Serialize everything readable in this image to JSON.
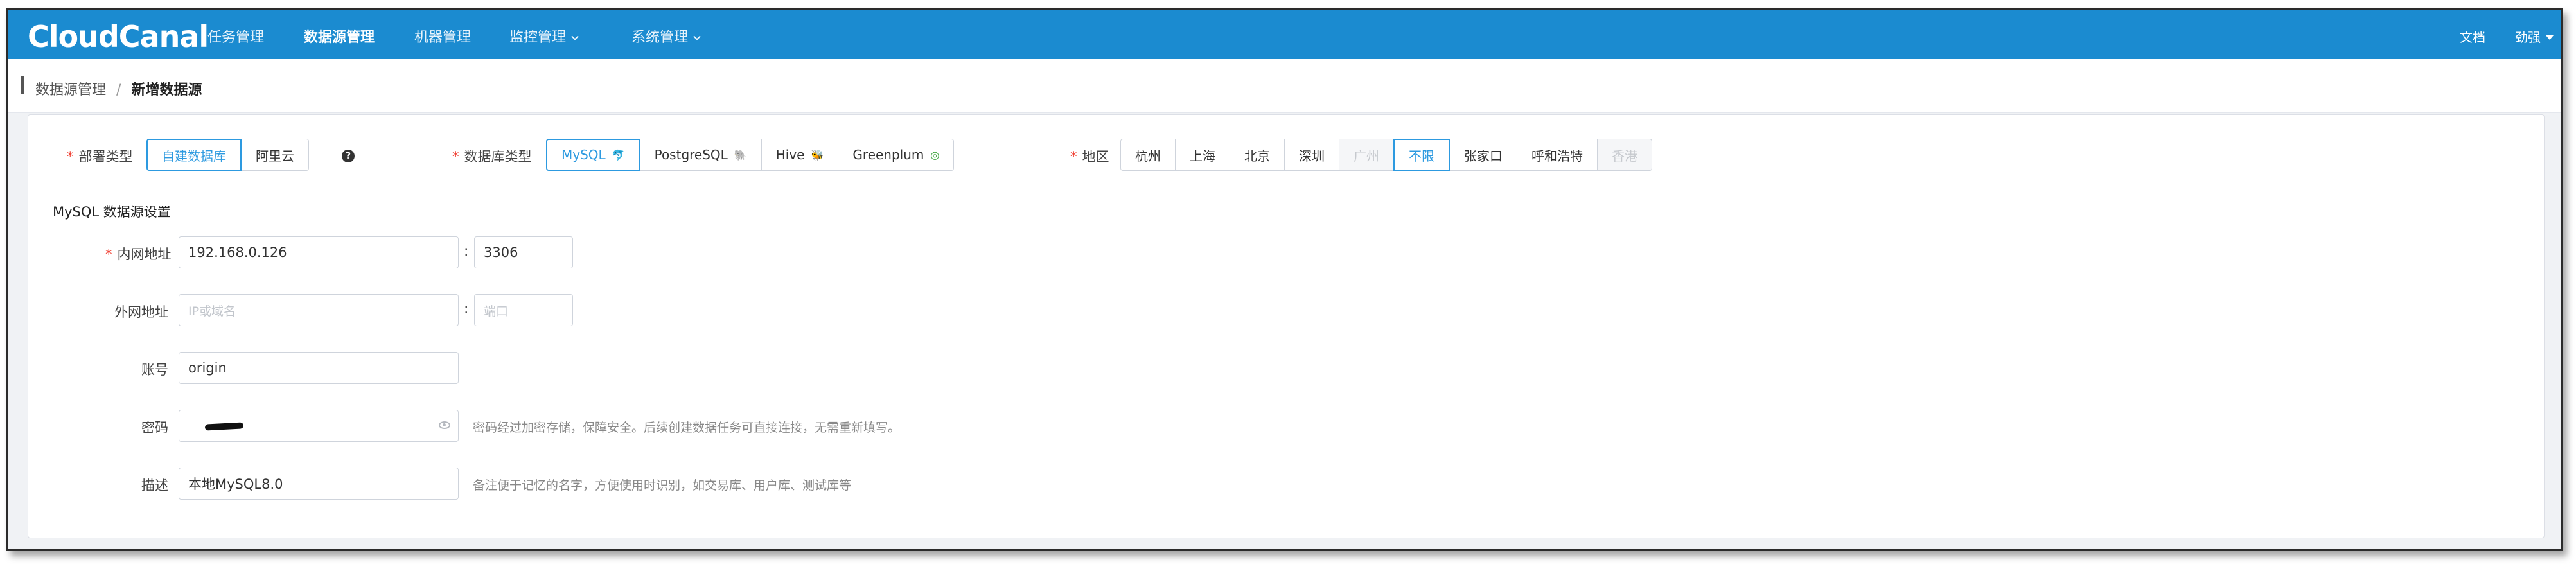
{
  "app": {
    "logo": "CloudCanal"
  },
  "nav": {
    "items": [
      {
        "label": "任务管理",
        "active": false
      },
      {
        "label": "数据源管理",
        "active": true
      },
      {
        "label": "机器管理",
        "active": false
      },
      {
        "label": "监控管理",
        "active": false,
        "dropdown": true
      },
      {
        "label": "系统管理",
        "active": false,
        "dropdown": true
      }
    ],
    "docs": "文档",
    "user": "劲强"
  },
  "breadcrumb": {
    "parent": "数据源管理",
    "separator": "/",
    "current": "新增数据源"
  },
  "form": {
    "deploy": {
      "label": "部署类型",
      "options": [
        "自建数据库",
        "阿里云"
      ],
      "selected": "自建数据库"
    },
    "dbtype": {
      "label": "数据库类型",
      "options": [
        {
          "label": "MySQL",
          "icon": "mysql-dolphin-icon"
        },
        {
          "label": "PostgreSQL",
          "icon": "postgres-elephant-icon"
        },
        {
          "label": "Hive",
          "icon": "hive-bee-icon"
        },
        {
          "label": "Greenplum",
          "icon": "greenplum-icon"
        }
      ],
      "selected": "MySQL"
    },
    "region": {
      "label": "地区",
      "options": [
        {
          "label": "杭州",
          "disabled": false
        },
        {
          "label": "上海",
          "disabled": false
        },
        {
          "label": "北京",
          "disabled": false
        },
        {
          "label": "深圳",
          "disabled": false
        },
        {
          "label": "广州",
          "disabled": true
        },
        {
          "label": "不限",
          "disabled": false
        },
        {
          "label": "张家口",
          "disabled": false
        },
        {
          "label": "呼和浩特",
          "disabled": false
        },
        {
          "label": "香港",
          "disabled": true
        }
      ],
      "selected": "不限"
    },
    "section_title": "MySQL 数据源设置",
    "internal": {
      "label": "内网地址",
      "host": "192.168.0.126",
      "port": "3306"
    },
    "external": {
      "label": "外网地址",
      "host_placeholder": "IP或域名",
      "port_placeholder": "端口"
    },
    "account": {
      "label": "账号",
      "value": "origin"
    },
    "password": {
      "label": "密码",
      "hint": "密码经过加密存储，保障安全。后续创建数据任务可直接连接，无需重新填写。"
    },
    "description": {
      "label": "描述",
      "value": "本地MySQL8.0",
      "hint": "备注便于记忆的名字，方便使用时识别，如交易库、用户库、测试库等"
    }
  },
  "colors": {
    "brand": "#1b8bd0",
    "accent": "#2d9ae0",
    "required": "#f04134"
  }
}
